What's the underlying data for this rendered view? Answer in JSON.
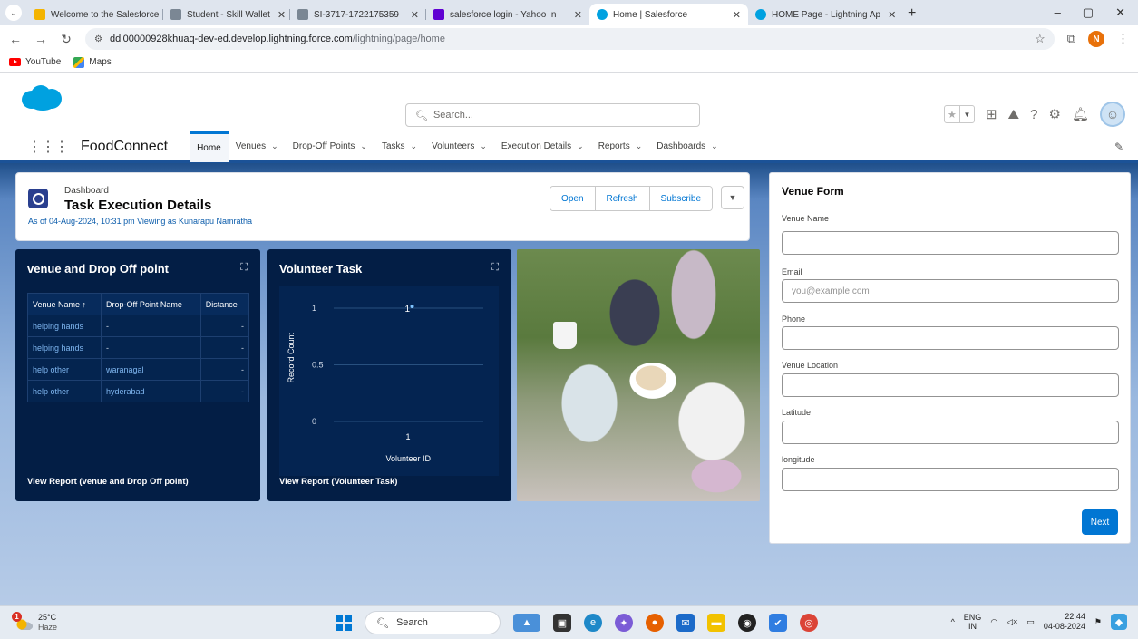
{
  "browser": {
    "tabs": [
      {
        "title": "Welcome to the Salesforce",
        "color": "#f4b400"
      },
      {
        "title": "Student - Skill Wallet",
        "color": "#5f6b7a"
      },
      {
        "title": "SI-3717-1722175359",
        "color": "#5f6b7a"
      },
      {
        "title": "salesforce login - Yahoo In",
        "color": "#6001d2"
      },
      {
        "title": "Home | Salesforce",
        "color": "#00a1e0"
      },
      {
        "title": "HOME Page - Lightning Ap",
        "color": "#00a1e0"
      }
    ],
    "new_tab": "+",
    "url_host": "ddl00000928khuaq-dev-ed.develop.lightning.force.com",
    "url_path": "/lightning/page/home",
    "profile_initial": "N",
    "bookmarks": [
      {
        "label": "YouTube"
      },
      {
        "label": "Maps"
      }
    ]
  },
  "header": {
    "search_placeholder": "Search...",
    "app_name": "FoodConnect",
    "nav": [
      {
        "label": "Home",
        "dropdown": false
      },
      {
        "label": "Venues",
        "dropdown": true
      },
      {
        "label": "Drop-Off Points",
        "dropdown": true
      },
      {
        "label": "Tasks",
        "dropdown": true
      },
      {
        "label": "Volunteers",
        "dropdown": true
      },
      {
        "label": "Execution Details",
        "dropdown": true
      },
      {
        "label": "Reports",
        "dropdown": true
      },
      {
        "label": "Dashboards",
        "dropdown": true
      }
    ]
  },
  "dashboard": {
    "subtitle": "Dashboard",
    "title": "Task Execution Details",
    "meta": "As of 04-Aug-2024, 10:31 pm Viewing as Kunarapu Namratha",
    "buttons": {
      "open": "Open",
      "refresh": "Refresh",
      "subscribe": "Subscribe"
    }
  },
  "widget_table": {
    "title": "venue and Drop Off point",
    "columns": [
      "Venue Name ↑",
      "Drop-Off Point Name",
      "Distance"
    ],
    "rows": [
      [
        "helping hands",
        "-",
        "-"
      ],
      [
        "helping hands",
        "-",
        "-"
      ],
      [
        "help other",
        "waranagal",
        "-"
      ],
      [
        "help other",
        "hyderabad",
        "-"
      ]
    ],
    "footer": "View Report (venue and Drop Off point)"
  },
  "widget_chart": {
    "title": "Volunteer Task",
    "footer": "View Report (Volunteer Task)"
  },
  "chart_data": {
    "type": "scatter",
    "title": "Volunteer Task",
    "xlabel": "Volunteer ID",
    "ylabel": "Record Count",
    "x_ticks": [
      "1"
    ],
    "y_ticks": [
      0,
      0.5,
      1
    ],
    "ylim": [
      0,
      1
    ],
    "points": [
      {
        "x": "1",
        "y": 1,
        "label": "1"
      }
    ],
    "grid": true
  },
  "venue_form": {
    "title": "Venue Form",
    "fields": [
      {
        "label": "Venue Name",
        "placeholder": "",
        "value": ""
      },
      {
        "label": "Email",
        "placeholder": "you@example.com",
        "value": ""
      },
      {
        "label": "Phone",
        "placeholder": "",
        "value": ""
      },
      {
        "label": "Venue Location",
        "placeholder": "",
        "value": ""
      },
      {
        "label": "Latitude",
        "placeholder": "",
        "value": ""
      },
      {
        "label": "longitude",
        "placeholder": "",
        "value": ""
      }
    ],
    "submit_label": "Next"
  },
  "taskbar": {
    "weather_temp": "25°C",
    "weather_desc": "Haze",
    "weather_badge": "1",
    "search_label": "Search",
    "lang_top": "ENG",
    "lang_bottom": "IN",
    "time": "22:44",
    "date": "04-08-2024"
  }
}
